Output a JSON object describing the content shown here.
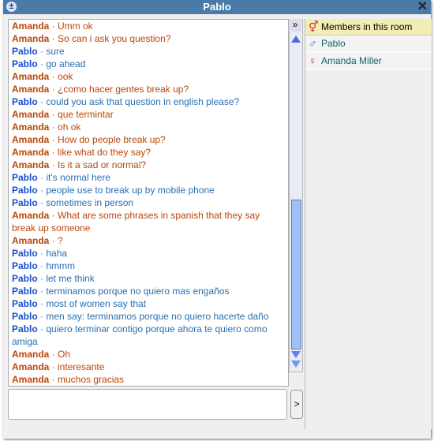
{
  "window": {
    "title": "Pablo"
  },
  "messages": [
    {
      "name": "Amanda",
      "text": "Umm ok"
    },
    {
      "name": "Amanda",
      "text": "So can i ask you question?"
    },
    {
      "name": "Pablo",
      "text": "sure"
    },
    {
      "name": "Pablo",
      "text": "go ahead"
    },
    {
      "name": "Amanda",
      "text": "ook"
    },
    {
      "name": "Amanda",
      "text": "¿como hacer gentes break up?"
    },
    {
      "name": "Pablo",
      "text": "could you ask that question in english please?"
    },
    {
      "name": "Amanda",
      "text": "que termintar"
    },
    {
      "name": "Amanda",
      "text": "oh ok"
    },
    {
      "name": "Amanda",
      "text": "How do people break up?"
    },
    {
      "name": "Amanda",
      "text": "like what do they say?"
    },
    {
      "name": "Amanda",
      "text": "Is it a sad or normal?"
    },
    {
      "name": "Pablo",
      "text": "it's normal here"
    },
    {
      "name": "Pablo",
      "text": "people use to break up by mobile phone"
    },
    {
      "name": "Pablo",
      "text": "sometimes in person"
    },
    {
      "name": "Amanda",
      "text": "What are some phrases in spanish that they say break up someone"
    },
    {
      "name": "Amanda",
      "text": "?"
    },
    {
      "name": "Pablo",
      "text": "haha"
    },
    {
      "name": "Pablo",
      "text": "hmmm"
    },
    {
      "name": "Pablo",
      "text": "let me think"
    },
    {
      "name": "Pablo",
      "text": "terminamos porque no quiero mas engaños"
    },
    {
      "name": "Pablo",
      "text": "most of women say that"
    },
    {
      "name": "Pablo",
      "text": "men say: terminamos porque no quiero hacerte daño"
    },
    {
      "name": "Pablo",
      "text": "quiero terminar contigo porque ahora te quiero como amiga"
    },
    {
      "name": "Amanda",
      "text": "Oh"
    },
    {
      "name": "Amanda",
      "text": "interesante"
    },
    {
      "name": "Amanda",
      "text": "muchos gracias"
    }
  ],
  "members": {
    "header": "Members in this room",
    "list": [
      {
        "name": "Pablo",
        "icon": "male-icon"
      },
      {
        "name": "Amanda Miller",
        "icon": "female-icon"
      }
    ]
  },
  "send_label": ">",
  "separator": " · ",
  "expand_label": "»"
}
